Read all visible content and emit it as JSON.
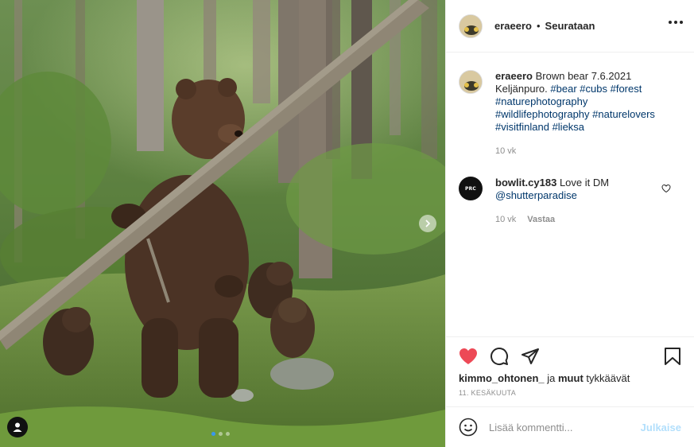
{
  "post": {
    "username": "eraeero",
    "separator": "•",
    "follow_label": "Seurataan",
    "caption_text": "Brown bear 7.6.2021 Keljänpuro.",
    "hashtags": [
      "#bear",
      "#cubs",
      "#forest",
      "#naturephotography",
      "#wildlifephotography",
      "#naturelovers",
      "#visitfinland",
      "#lieksa"
    ],
    "caption_time": "10 vk"
  },
  "comments": [
    {
      "username": "bowlit.cy183",
      "avatar_text": "PRC",
      "text": "Love it DM",
      "mention": "@shutterparadise",
      "time": "10 vk",
      "reply_label": "Vastaa"
    }
  ],
  "likes": {
    "user": "kimmo_ohtonen_",
    "connector": "ja",
    "others": "muut",
    "suffix": "tykkäävät"
  },
  "date_label": "11. KESÄKUUTA",
  "comment_input": {
    "placeholder": "Lisää kommentti...",
    "post_label": "Julkaise"
  },
  "icons": [
    "heart-filled-icon",
    "comment-icon",
    "share-icon",
    "bookmark-icon",
    "emoji-icon",
    "more-icon",
    "chevron-right-icon",
    "user-tag-icon"
  ],
  "colors": {
    "like_red": "#ed4956",
    "hashtag_blue": "#00376b",
    "post_button_disabled": "#b2dffc",
    "meta_gray": "#8e8e8e",
    "active_dot": "#3897f0"
  },
  "carousel": {
    "total": 3,
    "active": 1
  }
}
